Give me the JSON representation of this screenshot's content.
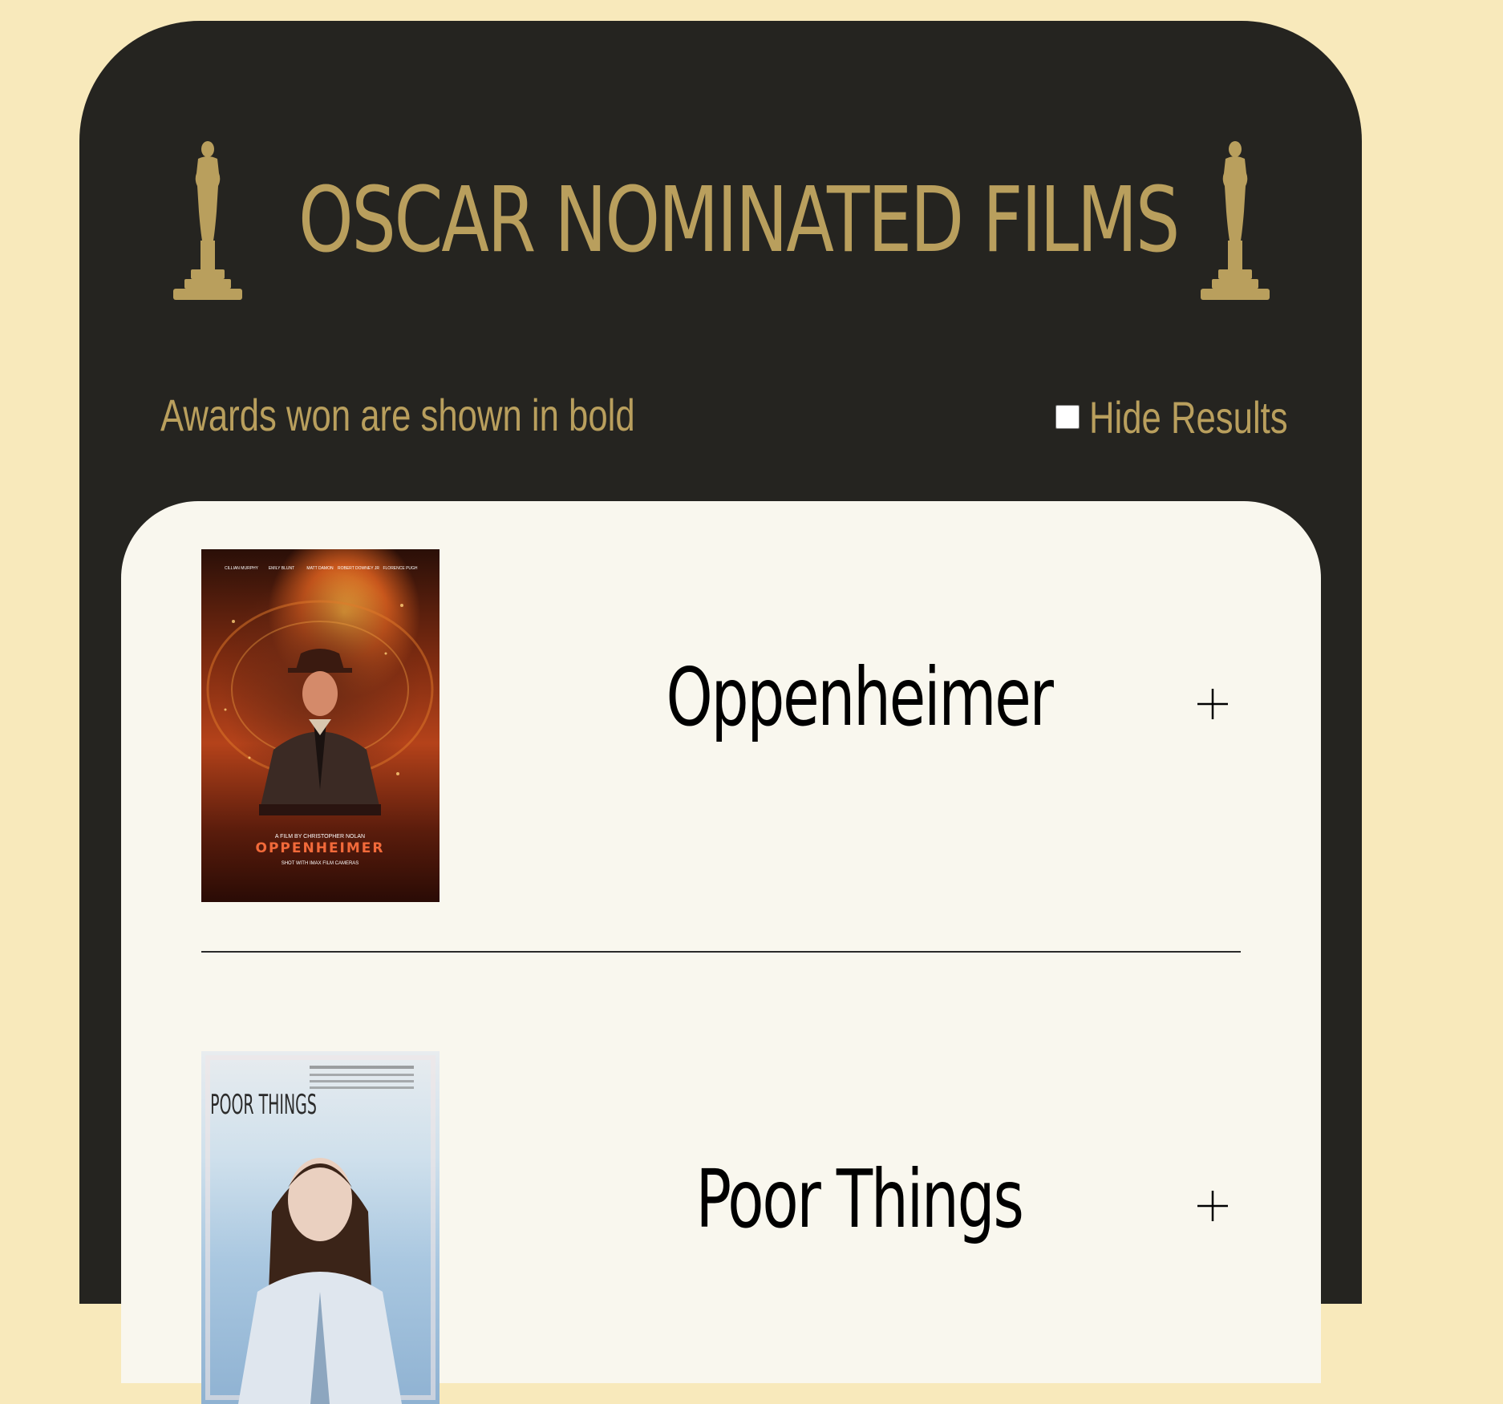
{
  "header": {
    "title": "OSCAR NOMINATED FILMS",
    "left_icon": "oscar-statuette-icon",
    "right_icon": "oscar-statuette-icon"
  },
  "controls": {
    "note": "Awards won are shown in bold",
    "hide_results_label": "Hide Results",
    "hide_results_checked": false
  },
  "films": [
    {
      "name": "Oppenheimer",
      "poster_icon": "oppenheimer-poster",
      "poster_text": [
        "CILLIAN MURPHY",
        "EMILY BLUNT",
        "MATT DAMON",
        "ROBERT DOWNEY JR",
        "FLORENCE PUGH",
        "A FILM BY CHRISTOPHER NOLAN",
        "OPPENHEIMER",
        "SHOT WITH IMAX FILM CAMERAS"
      ],
      "expand_icon": "plus-icon"
    },
    {
      "name": "Poor Things",
      "poster_icon": "poor-things-poster",
      "poster_text": [
        "POOR THINGS"
      ],
      "expand_icon": "plus-icon"
    }
  ],
  "colors": {
    "page_background": "#f8e9bb",
    "panel_background": "#252420",
    "gold_accent": "#b99f5d",
    "card_background": "#f9f7ee",
    "text_dark": "#000000"
  }
}
